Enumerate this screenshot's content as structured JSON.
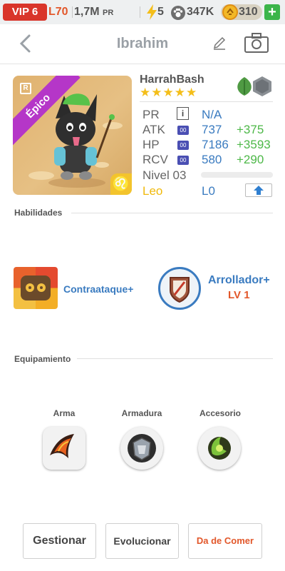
{
  "topbar": {
    "vip": "VIP 6",
    "level": "L70",
    "power_value": "1,7M",
    "power_unit": "PR",
    "energy": "5",
    "paws": "347K",
    "coins": "310",
    "add": "+"
  },
  "header": {
    "title": "Ibrahim"
  },
  "pet": {
    "name": "HarrahBash",
    "stars": "★★★★★",
    "rarity": "Épico",
    "rarity_tag": "R",
    "zodiac_symbol": "♌",
    "stats": [
      {
        "label": "PR",
        "value": "N/A",
        "bonus": ""
      },
      {
        "label": "ATK",
        "badge": "00",
        "value": "737",
        "bonus": "+375"
      },
      {
        "label": "HP",
        "badge": "00",
        "value": "7186",
        "bonus": "+3593"
      },
      {
        "label": "RCV",
        "badge": "00",
        "value": "580",
        "bonus": "+290"
      }
    ],
    "info_badge": "i",
    "nivel": "Nivel 03",
    "nivel_progress": 0,
    "sign": "Leo",
    "luck": "L0"
  },
  "skills": {
    "title": "Habilidades",
    "items": [
      {
        "label": "Contraataque+"
      },
      {
        "label": "Arrollador+",
        "level": "LV 1"
      }
    ]
  },
  "equipment": {
    "title": "Equipamiento",
    "slots": [
      {
        "label": "Arma"
      },
      {
        "label": "Armadura"
      },
      {
        "label": "Accesorio"
      }
    ]
  },
  "actions": {
    "manage": "Gestionar",
    "evolve": "Evolucionar",
    "feed": "Da de Comer"
  },
  "colors": {
    "accent_blue": "#3a7bc0",
    "bonus_green": "#4db848",
    "vip_red": "#d9352a",
    "orange": "#e2572a",
    "sign_yellow": "#f0b90b",
    "epic_purple": "#b536c8"
  }
}
